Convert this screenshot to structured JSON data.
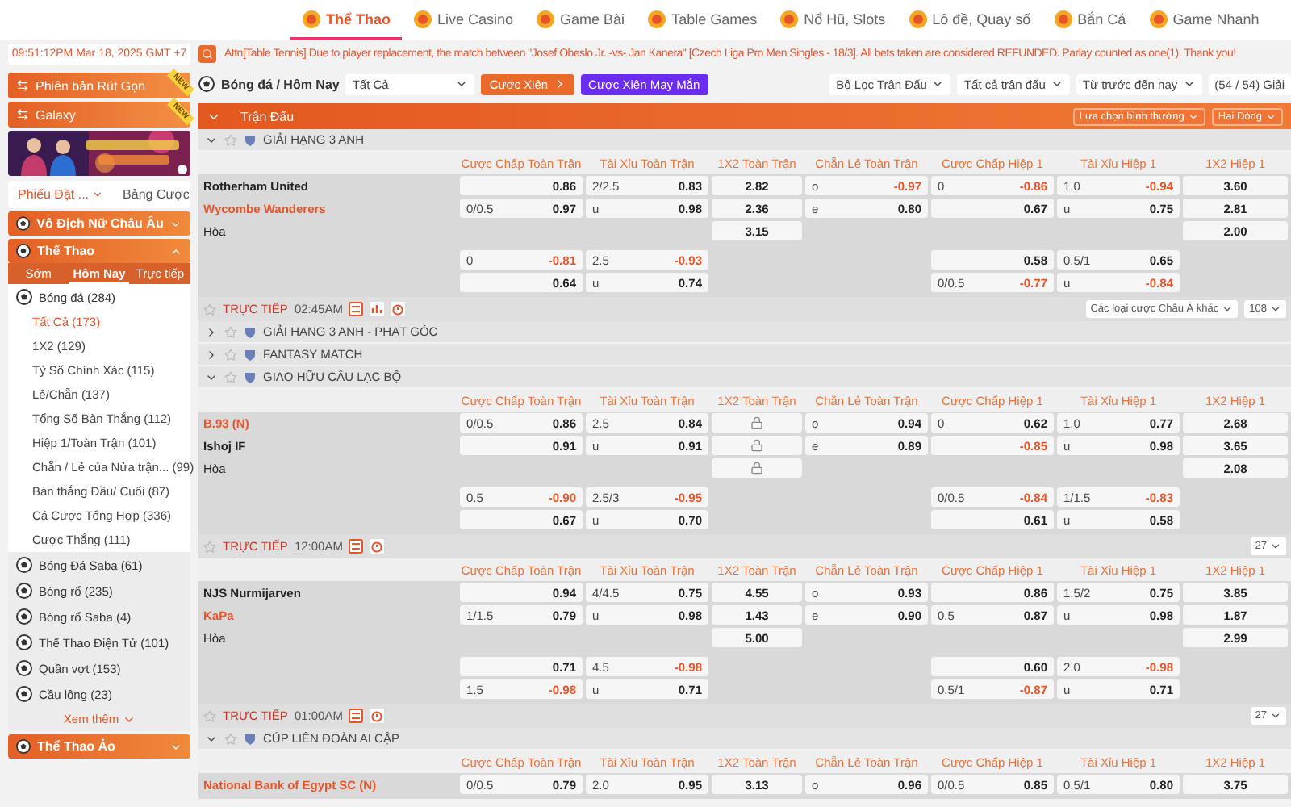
{
  "nav": {
    "tabs": [
      {
        "label": "Thể Thao",
        "selected": true
      },
      {
        "label": "Live Casino",
        "selected": false
      },
      {
        "label": "Game Bài",
        "selected": false
      },
      {
        "label": "Table Games",
        "selected": false
      },
      {
        "label": "Nổ Hũ, Slots",
        "selected": false
      },
      {
        "label": "Lô đề, Quay số",
        "selected": false
      },
      {
        "label": "Bắn Cá",
        "selected": false
      },
      {
        "label": "Game Nhanh",
        "selected": false
      }
    ]
  },
  "ticker": {
    "clock": "09:51:12PM Mar 18, 2025 GMT +7",
    "message": "Attn[Table Tennis] Due to player replacement, the match between \"Josef Obeslo Jr. -vs- Jan Kanera\" [Czech Liga Pro Men Singles - 18/3]. All bets taken are considered REFUNDED. Parlay counted as one(1). Thank you!"
  },
  "sidebar": {
    "quick_links": [
      {
        "label": "Phiên bản Rút Gọn",
        "badge": "NEW"
      },
      {
        "label": "Galaxy",
        "badge": "NEW"
      }
    ],
    "slip_tabs": [
      {
        "label": "Phiếu Đặt ...",
        "selected": true
      },
      {
        "label": "Bảng Cược",
        "selected": false
      }
    ],
    "sections": [
      {
        "title": "Vô Địch Nữ Châu Âu",
        "expanded": false
      },
      {
        "title": "Thể Thao",
        "expanded": true
      }
    ],
    "period_tabs": [
      {
        "label": "Sớm",
        "selected": false
      },
      {
        "label": "Hôm Nay",
        "selected": true
      },
      {
        "label": "Trực tiếp",
        "selected": false
      }
    ],
    "sports": [
      {
        "name": "Bóng đá (284)",
        "children": [
          {
            "name": "Tất Cả (173)",
            "selected": true
          },
          {
            "name": "1X2 (129)",
            "selected": false
          },
          {
            "name": "Tỷ Số Chính Xác (115)",
            "selected": false
          },
          {
            "name": "Lẻ/Chẵn (137)",
            "selected": false
          },
          {
            "name": "Tổng Số Bàn Thắng (112)",
            "selected": false
          },
          {
            "name": "Hiệp 1/Toàn Trận (101)",
            "selected": false
          },
          {
            "name": "Chẵn / Lẻ của Nửa trận... (99)",
            "selected": false
          },
          {
            "name": "Bàn thắng Đầu/ Cuối (87)",
            "selected": false
          },
          {
            "name": "Cá Cược Tổng Hợp (336)",
            "selected": false
          },
          {
            "name": "Cược Thắng (111)",
            "selected": false
          }
        ]
      },
      {
        "name": "Bóng Đá Saba (61)"
      },
      {
        "name": "Bóng rổ (235)"
      },
      {
        "name": "Bóng rổ Saba (4)"
      },
      {
        "name": "Thể Thao Điện Tử (101)"
      },
      {
        "name": "Quần vợt (153)"
      },
      {
        "name": "Cầu lông (23)"
      }
    ],
    "more": "Xem thêm",
    "footer_sections": [
      {
        "title": "Thể Thao Ảo",
        "expanded": false
      }
    ]
  },
  "toolbar": {
    "sport": "Bóng đá / Hôm Nay",
    "market_select": "Tất Cả",
    "parlay_button": "Cược Xiên",
    "lucky_parlay_button": "Cược Xiên May Mắn",
    "filters": [
      "Bộ Lọc Trận Đấu",
      "Tất cả trận đấu",
      "Từ trước đến nay"
    ],
    "league_count": "(54 / 54) Giải"
  },
  "section_bar": {
    "title": "Trận Đấu",
    "options": [
      "Lựa chọn bình thường",
      "Hai Dòng"
    ]
  },
  "blocks": [
    {
      "kind": "league",
      "name": "GIẢI HẠNG 3 ANH",
      "expanded": true
    },
    {
      "kind": "columns",
      "labels": [
        "Cược Chấp Toàn Trận",
        "Tài Xỉu Toàn Trận",
        "1X2 Toàn Trận",
        "Chẵn Lẻ Toàn Trận",
        "Cược Chấp Hiệp 1",
        "Tài Xỉu Hiệp 1",
        "1X2 Hiệp 1"
      ]
    },
    {
      "kind": "match",
      "rows": [
        {
          "kind": "team",
          "team": "Rotherham United",
          "favorite": false,
          "cells": [
            {
              "kind": "odds",
              "odds": "0.86",
              "negative": false
            },
            {
              "kind": "odds",
              "line": "2/2.5",
              "odds": "0.83",
              "negative": false
            },
            {
              "kind": "odds",
              "odds": "2.82",
              "negative": false
            },
            {
              "kind": "odds",
              "line": "o",
              "odds": "-0.97",
              "negative": true
            },
            {
              "kind": "odds",
              "line": "0",
              "odds": "-0.86",
              "negative": true
            },
            {
              "kind": "odds",
              "line": "1.0",
              "odds": "-0.94",
              "negative": true
            },
            {
              "kind": "odds",
              "odds": "3.60",
              "negative": false
            }
          ]
        },
        {
          "kind": "team",
          "team": "Wycombe Wanderers",
          "favorite": true,
          "cells": [
            {
              "kind": "odds",
              "line": "0/0.5",
              "odds": "0.97",
              "negative": false
            },
            {
              "kind": "odds",
              "line": "u",
              "odds": "0.98",
              "negative": false
            },
            {
              "kind": "odds",
              "odds": "2.36",
              "negative": false
            },
            {
              "kind": "odds",
              "line": "e",
              "odds": "0.80",
              "negative": false
            },
            {
              "kind": "odds",
              "odds": "0.67",
              "negative": false
            },
            {
              "kind": "odds",
              "line": "u",
              "odds": "0.75",
              "negative": false
            },
            {
              "kind": "odds",
              "odds": "2.81",
              "negative": false
            }
          ]
        },
        {
          "kind": "draw",
          "team": "Hòa",
          "cells": [
            null,
            null,
            {
              "kind": "odds",
              "odds": "3.15",
              "negative": false
            },
            null,
            null,
            null,
            {
              "kind": "odds",
              "odds": "2.00",
              "negative": false
            }
          ]
        },
        {
          "kind": "alt",
          "cells": [
            {
              "kind": "odds",
              "line": "0",
              "odds": "-0.81",
              "negative": true
            },
            {
              "kind": "odds",
              "line": "2.5",
              "odds": "-0.93",
              "negative": true
            },
            null,
            null,
            {
              "kind": "odds",
              "odds": "0.58",
              "negative": false
            },
            {
              "kind": "odds",
              "line": "0.5/1",
              "odds": "0.65",
              "negative": false
            },
            null
          ]
        },
        {
          "kind": "alt",
          "cells": [
            {
              "kind": "odds",
              "odds": "0.64",
              "negative": false
            },
            {
              "kind": "odds",
              "line": "u",
              "odds": "0.74",
              "negative": false
            },
            null,
            null,
            {
              "kind": "odds",
              "line": "0/0.5",
              "odds": "-0.77",
              "negative": true
            },
            {
              "kind": "odds",
              "line": "u",
              "odds": "-0.84",
              "negative": true
            },
            null
          ]
        }
      ]
    },
    {
      "kind": "live",
      "label": "TRỰC TIẾP",
      "time": "02:45AM",
      "stats": true,
      "more_bets": "Các loại cược Châu Á khác",
      "count": "108"
    },
    {
      "kind": "league",
      "name": "GIẢI HẠNG 3 ANH - PHẠT GÓC",
      "expanded": false
    },
    {
      "kind": "league",
      "name": "FANTASY MATCH",
      "expanded": false
    },
    {
      "kind": "league",
      "name": "GIAO HỮU CÂU LẠC BỘ",
      "expanded": true
    },
    {
      "kind": "columns",
      "labels": [
        "Cược Chấp Toàn Trận",
        "Tài Xỉu Toàn Trận",
        "1X2 Toàn Trận",
        "Chẵn Lẻ Toàn Trận",
        "Cược Chấp Hiệp 1",
        "Tài Xỉu Hiệp 1",
        "1X2 Hiệp 1"
      ]
    },
    {
      "kind": "match",
      "rows": [
        {
          "kind": "team",
          "team": "B.93 (N)",
          "favorite": true,
          "cells": [
            {
              "kind": "odds",
              "line": "0/0.5",
              "odds": "0.86",
              "negative": false
            },
            {
              "kind": "odds",
              "line": "2.5",
              "odds": "0.84",
              "negative": false
            },
            {
              "kind": "locked"
            },
            {
              "kind": "odds",
              "line": "o",
              "odds": "0.94",
              "negative": false
            },
            {
              "kind": "odds",
              "line": "0",
              "odds": "0.62",
              "negative": false
            },
            {
              "kind": "odds",
              "line": "1.0",
              "odds": "0.77",
              "negative": false
            },
            {
              "kind": "odds",
              "odds": "2.68",
              "negative": false
            }
          ]
        },
        {
          "kind": "team",
          "team": "Ishoj IF",
          "favorite": false,
          "cells": [
            {
              "kind": "odds",
              "odds": "0.91",
              "negative": false
            },
            {
              "kind": "odds",
              "line": "u",
              "odds": "0.91",
              "negative": false
            },
            {
              "kind": "locked"
            },
            {
              "kind": "odds",
              "line": "e",
              "odds": "0.89",
              "negative": false
            },
            {
              "kind": "odds",
              "odds": "-0.85",
              "negative": true
            },
            {
              "kind": "odds",
              "line": "u",
              "odds": "0.98",
              "negative": false
            },
            {
              "kind": "odds",
              "odds": "3.65",
              "negative": false
            }
          ]
        },
        {
          "kind": "draw",
          "team": "Hòa",
          "cells": [
            null,
            null,
            {
              "kind": "locked"
            },
            null,
            null,
            null,
            {
              "kind": "odds",
              "odds": "2.08",
              "negative": false
            }
          ]
        },
        {
          "kind": "alt",
          "cells": [
            {
              "kind": "odds",
              "line": "0.5",
              "odds": "-0.90",
              "negative": true
            },
            {
              "kind": "odds",
              "line": "2.5/3",
              "odds": "-0.95",
              "negative": true
            },
            null,
            null,
            {
              "kind": "odds",
              "line": "0/0.5",
              "odds": "-0.84",
              "negative": true
            },
            {
              "kind": "odds",
              "line": "1/1.5",
              "odds": "-0.83",
              "negative": true
            },
            null
          ]
        },
        {
          "kind": "alt",
          "cells": [
            {
              "kind": "odds",
              "odds": "0.67",
              "negative": false
            },
            {
              "kind": "odds",
              "line": "u",
              "odds": "0.70",
              "negative": false
            },
            null,
            null,
            {
              "kind": "odds",
              "odds": "0.61",
              "negative": false
            },
            {
              "kind": "odds",
              "line": "u",
              "odds": "0.58",
              "negative": false
            },
            null
          ]
        }
      ]
    },
    {
      "kind": "live",
      "label": "TRỰC TIẾP",
      "time": "12:00AM",
      "stats": false,
      "count": "27"
    },
    {
      "kind": "columns",
      "labels": [
        "Cược Chấp Toàn Trận",
        "Tài Xỉu Toàn Trận",
        "1X2 Toàn Trận",
        "Chẵn Lẻ Toàn Trận",
        "Cược Chấp Hiệp 1",
        "Tài Xỉu Hiệp 1",
        "1X2 Hiệp 1"
      ]
    },
    {
      "kind": "match",
      "rows": [
        {
          "kind": "team",
          "team": "NJS Nurmijarven",
          "favorite": false,
          "cells": [
            {
              "kind": "odds",
              "odds": "0.94",
              "negative": false
            },
            {
              "kind": "odds",
              "line": "4/4.5",
              "odds": "0.75",
              "negative": false
            },
            {
              "kind": "odds",
              "odds": "4.55",
              "negative": false
            },
            {
              "kind": "odds",
              "line": "o",
              "odds": "0.93",
              "negative": false
            },
            {
              "kind": "odds",
              "odds": "0.86",
              "negative": false
            },
            {
              "kind": "odds",
              "line": "1.5/2",
              "odds": "0.75",
              "negative": false
            },
            {
              "kind": "odds",
              "odds": "3.85",
              "negative": false
            }
          ]
        },
        {
          "kind": "team",
          "team": "KaPa",
          "favorite": true,
          "cells": [
            {
              "kind": "odds",
              "line": "1/1.5",
              "odds": "0.79",
              "negative": false
            },
            {
              "kind": "odds",
              "line": "u",
              "odds": "0.98",
              "negative": false
            },
            {
              "kind": "odds",
              "odds": "1.43",
              "negative": false
            },
            {
              "kind": "odds",
              "line": "e",
              "odds": "0.90",
              "negative": false
            },
            {
              "kind": "odds",
              "line": "0.5",
              "odds": "0.87",
              "negative": false
            },
            {
              "kind": "odds",
              "line": "u",
              "odds": "0.98",
              "negative": false
            },
            {
              "kind": "odds",
              "odds": "1.87",
              "negative": false
            }
          ]
        },
        {
          "kind": "draw",
          "team": "Hòa",
          "cells": [
            null,
            null,
            {
              "kind": "odds",
              "odds": "5.00",
              "negative": false
            },
            null,
            null,
            null,
            {
              "kind": "odds",
              "odds": "2.99",
              "negative": false
            }
          ]
        },
        {
          "kind": "alt",
          "cells": [
            {
              "kind": "odds",
              "odds": "0.71",
              "negative": false
            },
            {
              "kind": "odds",
              "line": "4.5",
              "odds": "-0.98",
              "negative": true
            },
            null,
            null,
            {
              "kind": "odds",
              "odds": "0.60",
              "negative": false
            },
            {
              "kind": "odds",
              "line": "2.0",
              "odds": "-0.98",
              "negative": true
            },
            null
          ]
        },
        {
          "kind": "alt",
          "cells": [
            {
              "kind": "odds",
              "line": "1.5",
              "odds": "-0.98",
              "negative": true
            },
            {
              "kind": "odds",
              "line": "u",
              "odds": "0.71",
              "negative": false
            },
            null,
            null,
            {
              "kind": "odds",
              "line": "0.5/1",
              "odds": "-0.87",
              "negative": true
            },
            {
              "kind": "odds",
              "line": "u",
              "odds": "0.71",
              "negative": false
            },
            null
          ]
        }
      ]
    },
    {
      "kind": "live",
      "label": "TRỰC TIẾP",
      "time": "01:00AM",
      "stats": false,
      "count": "27"
    },
    {
      "kind": "league",
      "name": "CÚP LIÊN ĐOÀN AI CẬP",
      "expanded": true
    },
    {
      "kind": "columns",
      "labels": [
        "Cược Chấp Toàn Trận",
        "Tài Xỉu Toàn Trận",
        "1X2 Toàn Trận",
        "Chẵn Lẻ Toàn Trận",
        "Cược Chấp Hiệp 1",
        "Tài Xỉu Hiệp 1",
        "1X2 Hiệp 1"
      ]
    },
    {
      "kind": "match",
      "rows": [
        {
          "kind": "team",
          "team": "National Bank of Egypt SC (N)",
          "favorite": true,
          "cells": [
            {
              "kind": "odds",
              "line": "0/0.5",
              "odds": "0.79",
              "negative": false
            },
            {
              "kind": "odds",
              "line": "2.0",
              "odds": "0.95",
              "negative": false
            },
            {
              "kind": "odds",
              "odds": "3.13",
              "negative": false
            },
            {
              "kind": "odds",
              "line": "o",
              "odds": "0.96",
              "negative": false
            },
            {
              "kind": "odds",
              "line": "0/0.5",
              "odds": "0.85",
              "negative": false
            },
            {
              "kind": "odds",
              "line": "0.5/1",
              "odds": "0.80",
              "negative": false
            },
            {
              "kind": "odds",
              "odds": "3.75",
              "negative": false
            }
          ]
        }
      ]
    }
  ]
}
